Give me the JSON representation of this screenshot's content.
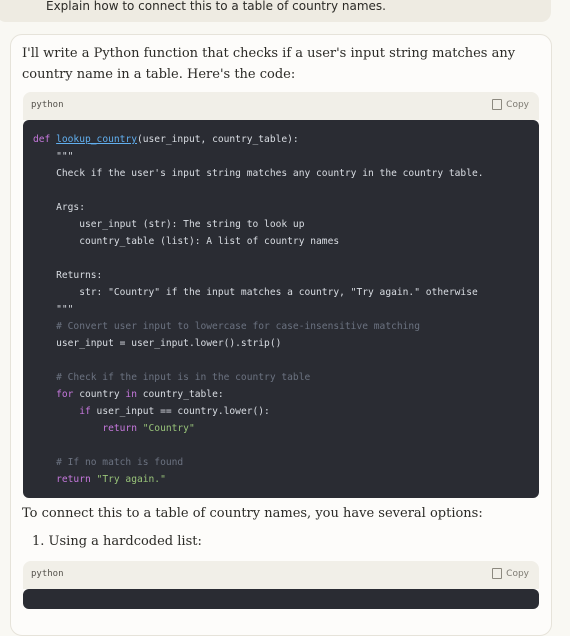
{
  "user_message": "Explain how to connect this to a table of country names.",
  "reply": {
    "intro": "I'll write a Python function that checks if a user's input string matches any country name in a table. Here's the code:",
    "after_code": "To connect this to a table of country names, you have several options:",
    "list_item_1": "1. Using a hardcoded list:"
  },
  "code_block_1": {
    "lang": "python",
    "copy_label": "Copy",
    "lines": [
      "def lookup_country(user_input, country_table):",
      "    \"\"\"",
      "    Check if the user's input string matches any country in the country table.",
      "",
      "    Args:",
      "        user_input (str): The string to look up",
      "        country_table (list): A list of country names",
      "",
      "    Returns:",
      "        str: \"Country\" if the input matches a country, \"Try again.\" otherwise",
      "    \"\"\"",
      "    # Convert user input to lowercase for case-insensitive matching",
      "    user_input = user_input.lower().strip()",
      "",
      "    # Check if the input is in the country table",
      "    for country in country_table:",
      "        if user_input == country.lower():",
      "            return \"Country\"",
      "",
      "    # If no match is found",
      "    return \"Try again.\""
    ]
  },
  "code_block_2": {
    "lang": "python",
    "copy_label": "Copy"
  },
  "colors": {
    "background": "#f9f8f3",
    "code_bg": "#2a2c33",
    "keyword": "#c678dd",
    "function": "#61afef",
    "string": "#98c379",
    "comment": "#6b7280"
  }
}
